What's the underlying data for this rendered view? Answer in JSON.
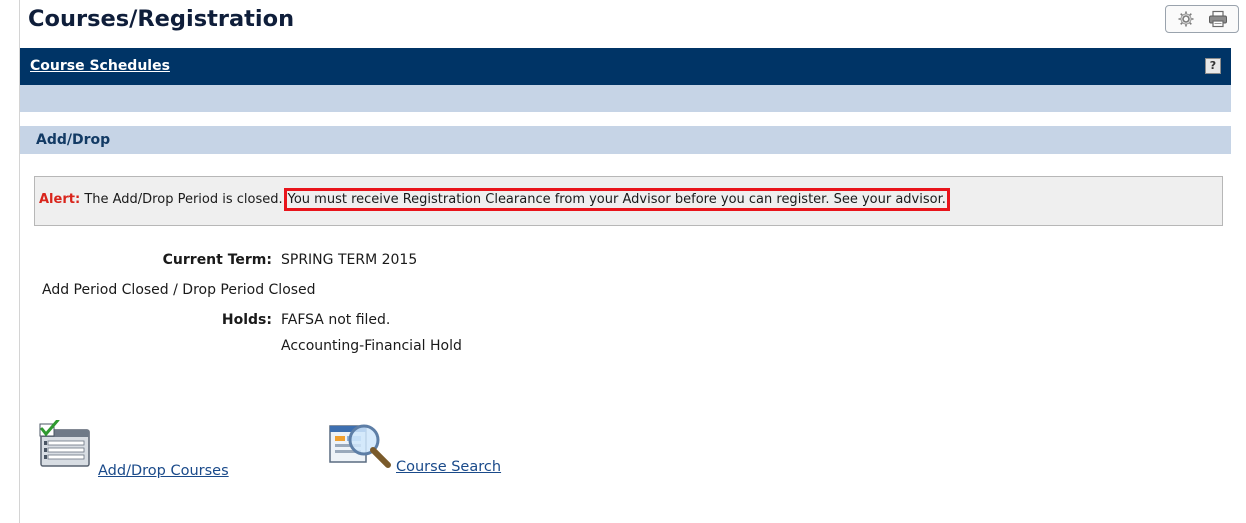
{
  "page": {
    "title": "Courses/Registration"
  },
  "toolbar": {
    "settings_icon": "gear-icon",
    "print_icon": "printer-icon"
  },
  "header": {
    "link_label": "Course Schedules",
    "help_label": "?"
  },
  "section": {
    "title": "Add/Drop"
  },
  "alert": {
    "label": "Alert:",
    "message": "The Add/Drop Period is closed.",
    "highlighted": "You must receive Registration Clearance from your Advisor before you can register. See your advisor.",
    "label_color": "#d9251c",
    "highlight_color": "#e8141b"
  },
  "term": {
    "label": "Current Term:",
    "value": "SPRING TERM 2015",
    "period_status": "Add Period Closed / Drop Period Closed"
  },
  "holds": {
    "label": "Holds:",
    "items": [
      "FAFSA not filed.",
      "Accounting-Financial Hold"
    ]
  },
  "actions": {
    "add_drop_label": "Add/Drop Courses",
    "add_drop_icon": "checklist-icon",
    "course_search_label": "Course Search",
    "course_search_icon": "magnifier-icon"
  },
  "colors": {
    "header_bg": "#003466",
    "band_bg": "#c6d4e6",
    "link": "#1a4a8a"
  }
}
